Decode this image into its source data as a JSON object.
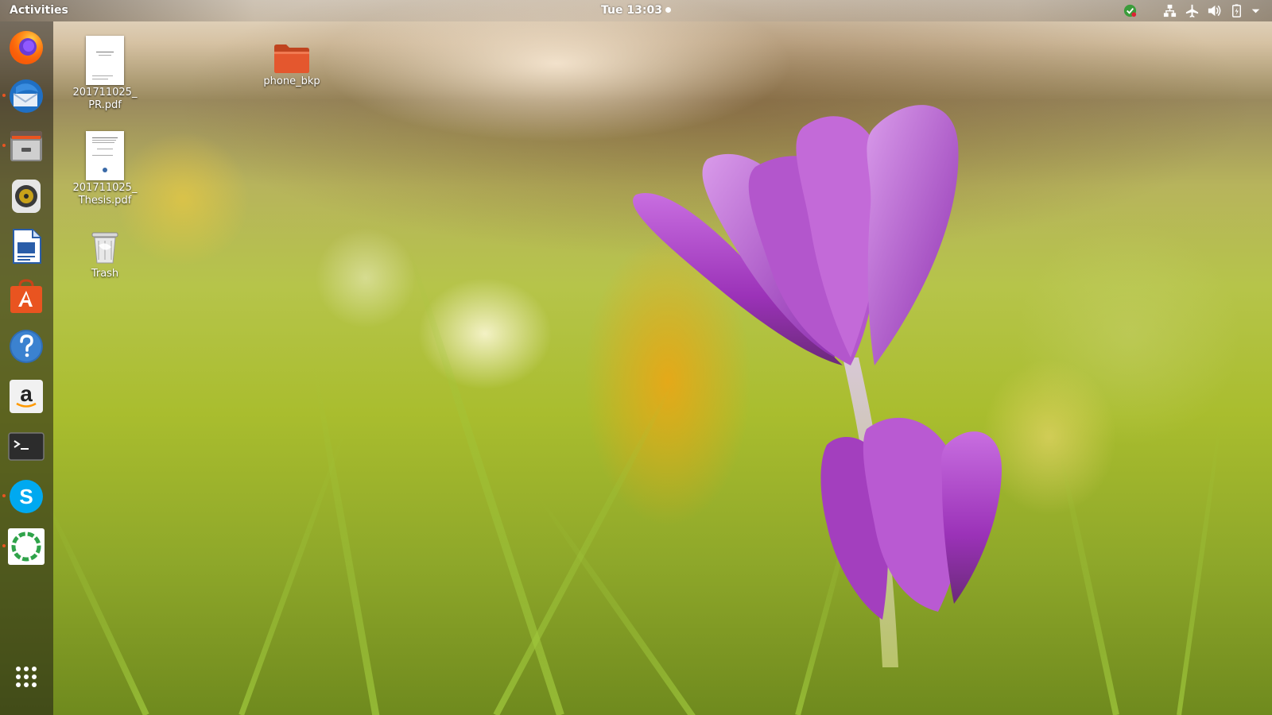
{
  "topbar": {
    "activities_label": "Activities",
    "clock": "Tue 13:03"
  },
  "tray_icons": [
    "update-check-icon",
    "network-wired-icon",
    "airplane-mode-icon",
    "volume-icon",
    "battery-icon",
    "system-menu-chevron-icon"
  ],
  "dock": {
    "items": [
      {
        "name": "firefox",
        "running": false
      },
      {
        "name": "thunderbird",
        "running": true
      },
      {
        "name": "files",
        "running": true
      },
      {
        "name": "rhythmbox",
        "running": false
      },
      {
        "name": "libreoffice-writer",
        "running": false
      },
      {
        "name": "ubuntu-software",
        "running": false
      },
      {
        "name": "help",
        "running": false
      },
      {
        "name": "amazon",
        "running": false
      },
      {
        "name": "terminal",
        "running": false
      },
      {
        "name": "skype",
        "running": true
      },
      {
        "name": "unknown-app",
        "running": true
      }
    ],
    "show_apps_icon": "app-grid-icon"
  },
  "desktop": {
    "icons": [
      {
        "label_line1": "201711025_",
        "label_line2": "PR.pdf",
        "kind": "pdf"
      },
      {
        "label_line1": "201711025_",
        "label_line2": "Thesis.pdf",
        "kind": "pdf"
      },
      {
        "label": "Trash",
        "kind": "trash"
      },
      {
        "label": "phone_bkp",
        "kind": "folder"
      }
    ]
  },
  "colors": {
    "ubuntu_orange": "#e95420",
    "folder": "#e4572e",
    "crocus_purple": "#b84fd1"
  }
}
